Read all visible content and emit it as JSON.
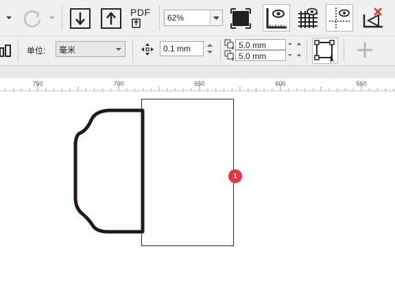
{
  "toolbar": {
    "pdf_label": "PDF",
    "zoom_value": "62%"
  },
  "property_bar": {
    "unit_label": "单位:",
    "unit_value": "毫米",
    "nudge_value": "0.1 mm",
    "duplicate_x": "5.0 mm",
    "duplicate_y": "5.0 mm"
  },
  "ruler": {
    "ticks": [
      "750",
      "700",
      "650",
      "600",
      "550"
    ]
  },
  "canvas": {
    "badge_number": "1"
  },
  "colors": {
    "badge": "#e8343b",
    "shape_stroke": "#231815",
    "accent_red": "#e0302a"
  }
}
